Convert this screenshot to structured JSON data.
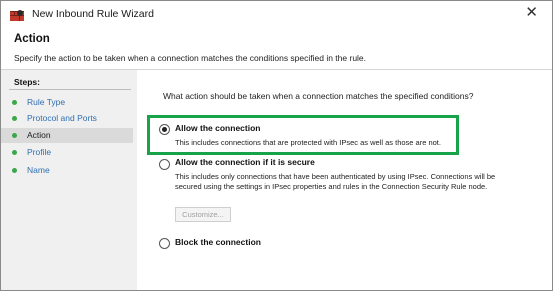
{
  "window": {
    "title": "New Inbound Rule Wizard",
    "close_glyph": "✕"
  },
  "header": {
    "title": "Action",
    "description": "Specify the action to be taken when a connection matches the conditions specified in the rule."
  },
  "sidebar": {
    "title": "Steps:",
    "items": [
      {
        "label": "Rule Type",
        "active": false
      },
      {
        "label": "Protocol and Ports",
        "active": false
      },
      {
        "label": "Action",
        "active": true
      },
      {
        "label": "Profile",
        "active": false
      },
      {
        "label": "Name",
        "active": false
      }
    ]
  },
  "main": {
    "question": "What action should be taken when a connection matches the specified conditions?",
    "options": [
      {
        "label": "Allow the connection",
        "description": "This includes connections that are protected with IPsec as well as those are not.",
        "checked": true
      },
      {
        "label": "Allow the connection if it is secure",
        "description": "This includes only connections that have been authenticated by using IPsec.  Connections will be secured using the settings in IPsec properties and rules in the Connection Security Rule node.",
        "checked": false
      },
      {
        "label": "Block the connection",
        "description": "",
        "checked": false
      }
    ],
    "customize_button": "Customize..."
  },
  "colors": {
    "highlight_border": "#16a34a",
    "step_dot": "#3ba64a",
    "link_text": "#2e6fb2"
  },
  "icons": {
    "title_icon": "firewall-shield-icon",
    "close_icon": "close-icon",
    "step_bullet": "green-dot-icon"
  }
}
